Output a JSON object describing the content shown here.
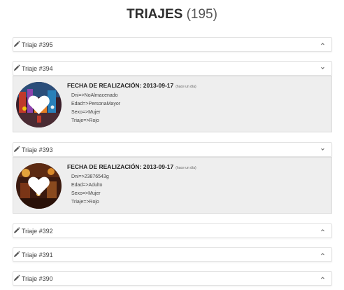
{
  "header": {
    "title": "TRIAJES",
    "count": "(195)"
  },
  "triajes": [
    {
      "label": "Triaje #395",
      "chevron": "up"
    },
    {
      "label": "Triaje #394",
      "chevron": "down",
      "details": {
        "date_label": "FECHA DE REALIZACIÓN: 2013-09-17",
        "relative": "(hace un día)",
        "dni": "Dni=>NoAlmacenado",
        "edad": "Edad=>PersonaMayor",
        "sexo": "Sexo=>Mujer",
        "triaje": "Triaje=>Rojo"
      }
    },
    {
      "label": "Triaje #393",
      "chevron": "down",
      "details": {
        "date_label": "FECHA DE REALIZACIÓN: 2013-09-17",
        "relative": "(hace un día)",
        "dni": "Dni=>23876543g",
        "edad": "Edad=>Adulto",
        "sexo": "Sexo=>Mujer",
        "triaje": "Triaje=>Rojo"
      }
    },
    {
      "label": "Triaje #392",
      "chevron": "up"
    },
    {
      "label": "Triaje #391",
      "chevron": "up"
    },
    {
      "label": "Triaje #390",
      "chevron": "up"
    }
  ],
  "colors": {
    "accent": "#333333",
    "panel_bg": "#eeeeee",
    "border": "#e3e3e3"
  },
  "icons": {
    "edit": "pencil-icon",
    "heart": "heart-icon",
    "chevron_up": "chevron-up-icon",
    "chevron_down": "chevron-down-icon"
  }
}
